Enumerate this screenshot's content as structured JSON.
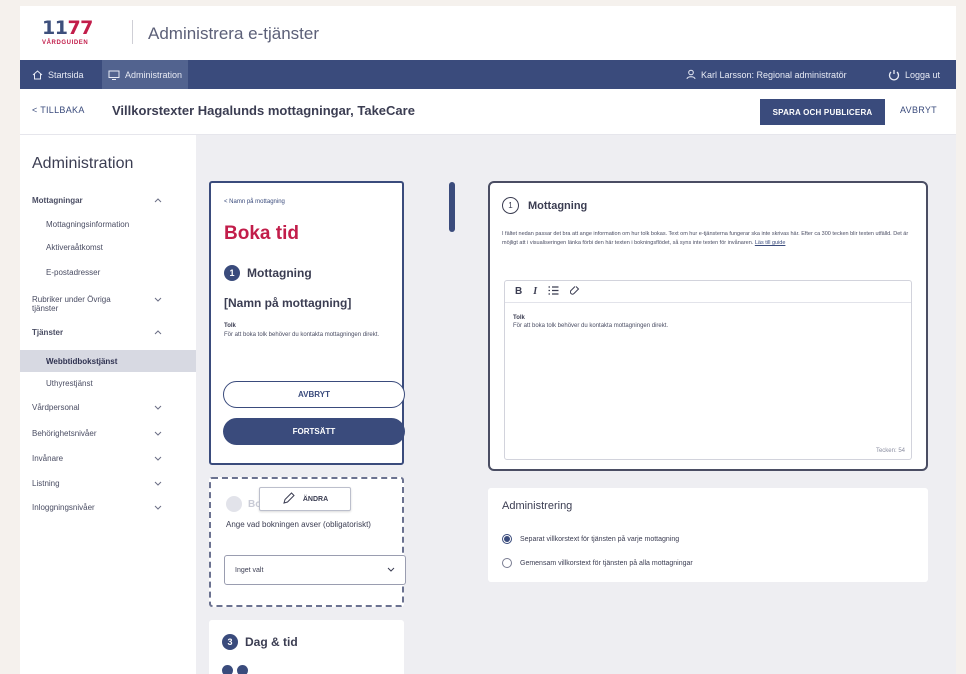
{
  "header": {
    "logo_number": "1177",
    "logo_sub": "VÅRDGUIDEN",
    "app_title": "Administrera e-tjänster"
  },
  "nav": {
    "home": "Startsida",
    "admin": "Administration",
    "user": "Karl Larsson: Regional administratör",
    "logout": "Logga ut"
  },
  "titlebar": {
    "back": "TILLBAKA",
    "title": "Villkorstexter Hagalunds mottagningar, TakeCare",
    "publish": "SPARA OCH PUBLICERA",
    "cancel": "AVBRYT"
  },
  "sidebar": {
    "title": "Administration",
    "items": [
      {
        "label": "Mottagningar",
        "chev": "^",
        "indent": false,
        "bold": true
      },
      {
        "label": "Mottagningsinformation",
        "chev": "",
        "indent": true
      },
      {
        "label": "Aktiveraåtkomst",
        "chev": "",
        "indent": true
      },
      {
        "label": "E-postadresser",
        "chev": "",
        "indent": true
      },
      {
        "label": "Rubriker under Övriga tjänster",
        "chev": "v",
        "indent": false
      },
      {
        "label": "Tjänster",
        "chev": "^",
        "indent": false,
        "bold": true
      },
      {
        "label": "Webbtidbokstjänst",
        "chev": "",
        "indent": true,
        "active": true
      },
      {
        "label": "Uthyrestjänst",
        "chev": "",
        "indent": true
      },
      {
        "label": "Vårdpersonal",
        "chev": "v",
        "indent": false
      },
      {
        "label": "Behörighetsnivåer",
        "chev": "v",
        "indent": false
      },
      {
        "label": "Invånare",
        "chev": "v",
        "indent": false
      },
      {
        "label": "Listning",
        "chev": "v",
        "indent": false
      },
      {
        "label": "Inloggningsnivåer",
        "chev": "v",
        "indent": false
      }
    ]
  },
  "preview": {
    "crumb": "< Namn på mottagning",
    "heading": "Boka tid",
    "step1_num": "1",
    "step1_label": "Mottagning",
    "clinic_name": "[Namn på mottagning]",
    "note_heading": "Tolk",
    "note_text": "För att boka tolk behöver du kontakta mottagningen direkt.",
    "cancel": "AVBRYT",
    "continue": "FORTSÄTT",
    "step2_label_ghost": "Bo",
    "edit": "ÄNDRA",
    "field_label": "Ange vad bokningen avser (obligatoriskt)",
    "select_value": "Inget valt",
    "step3_num": "3",
    "step3_label": "Dag & tid"
  },
  "editor_card": {
    "num": "1",
    "title": "Mottagning",
    "info": "I fältet nedan passar det bra att ange information om hur tolk bokas. Text om hur e-tjänsterna fungerar ska inte skrivas här. Efter ca 300 tecken blir texten utfälld. Det är möjligt att i visualiseringen länka förbi den här texten i bokningsflödet, så syns inte texten för invånaren.",
    "info_link": "Läs till guide",
    "toolbar": {
      "bold": "B",
      "italic": "I",
      "list": "≣",
      "link": "🔗"
    },
    "body_heading": "Tolk",
    "body_text": "För att boka tolk behöver du kontakta mottagningen direkt.",
    "counter": "Tecken: 54"
  },
  "admin_card": {
    "title": "Administrering",
    "options": [
      {
        "label": "Separat villkorstext för tjänsten på varje mottagning",
        "selected": true
      },
      {
        "label": "Gemensam villkorstext för tjänsten på alla mottagningar",
        "selected": false
      }
    ]
  },
  "colors": {
    "brand_blue": "#3a4b7c",
    "brand_red": "#c21d4a"
  }
}
